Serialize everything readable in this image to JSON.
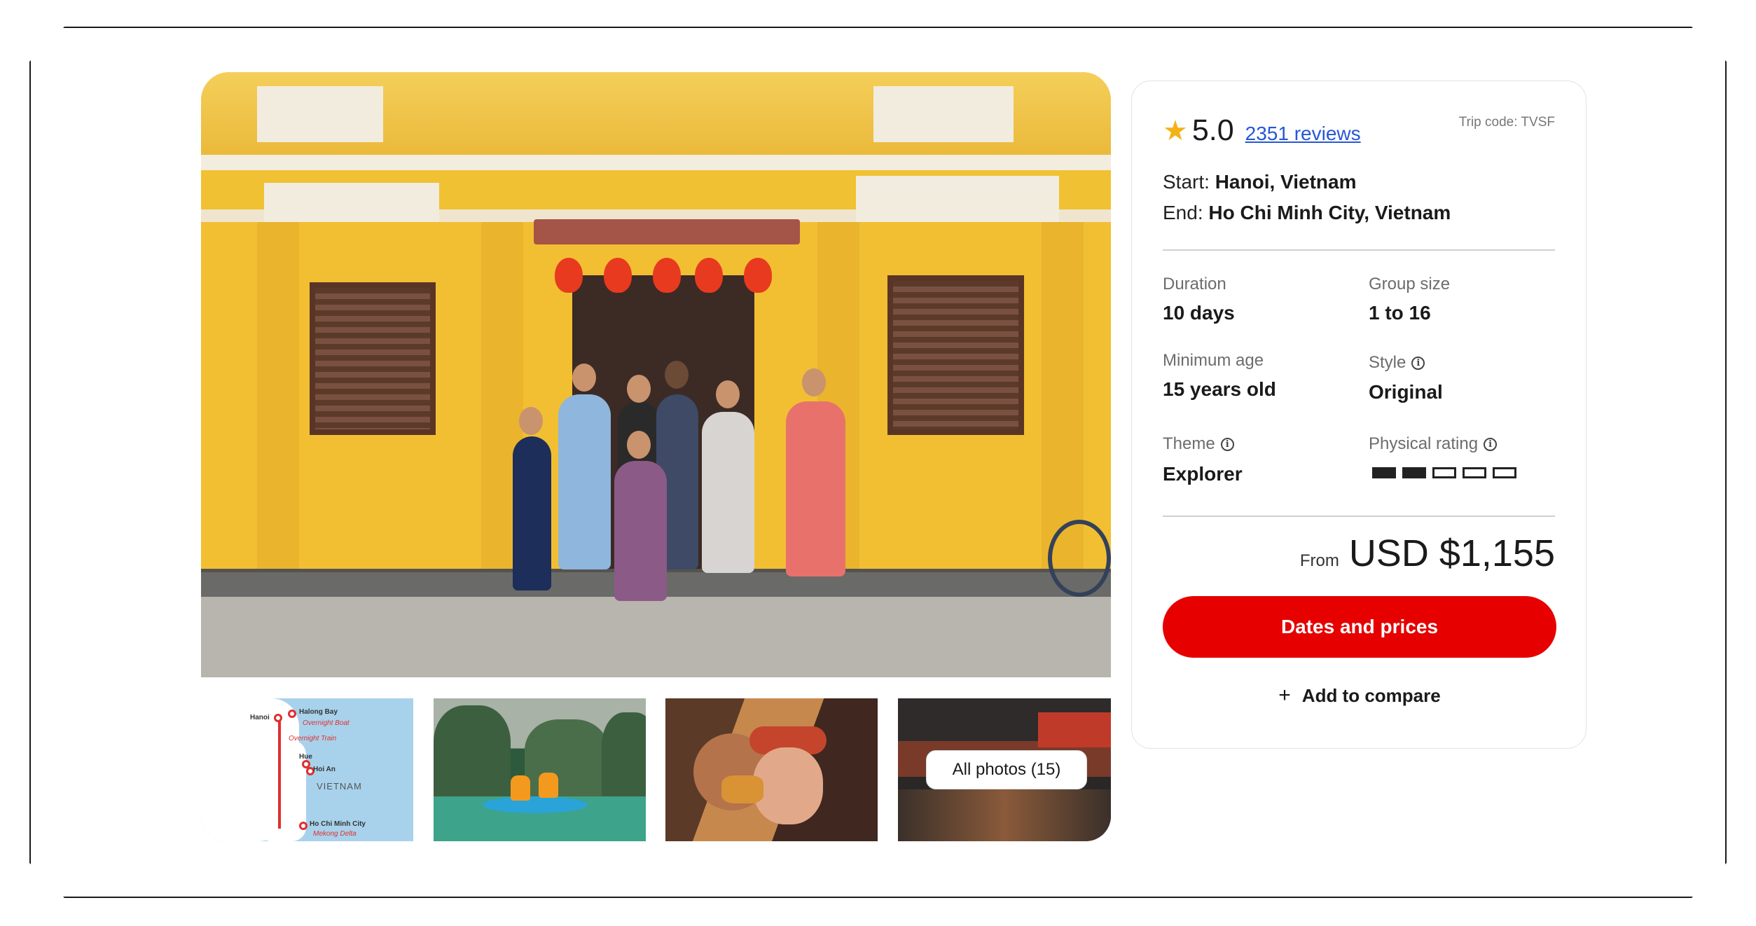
{
  "gallery": {
    "all_photos_label": "All photos (15)",
    "map": {
      "labels": [
        "Hanoi",
        "Halong Bay",
        "Overnight Boat",
        "Overnight Train",
        "Hue",
        "Hoi An",
        "VIETNAM",
        "Ho Chi Minh City",
        "Mekong Delta"
      ]
    }
  },
  "trip": {
    "rating": "5.0",
    "reviews_label": "2351 reviews",
    "trip_code": "Trip code: TVSF",
    "start_label": "Start:",
    "start_value": "Hanoi, Vietnam",
    "end_label": "End:",
    "end_value": "Ho Chi Minh City, Vietnam",
    "details": {
      "duration_label": "Duration",
      "duration_value": "10 days",
      "group_label": "Group size",
      "group_value": "1 to 16",
      "age_label": "Minimum age",
      "age_value": "15 years old",
      "style_label": "Style",
      "style_value": "Original",
      "theme_label": "Theme",
      "theme_value": "Explorer",
      "physical_label": "Physical rating",
      "physical_rating": 2,
      "physical_max": 5
    },
    "from_label": "From",
    "price": "USD $1,155",
    "cta_label": "Dates and prices",
    "compare_label": "Add to compare"
  },
  "colors": {
    "cta": "#e60000",
    "star": "#f2b316",
    "link": "#2757d6"
  }
}
